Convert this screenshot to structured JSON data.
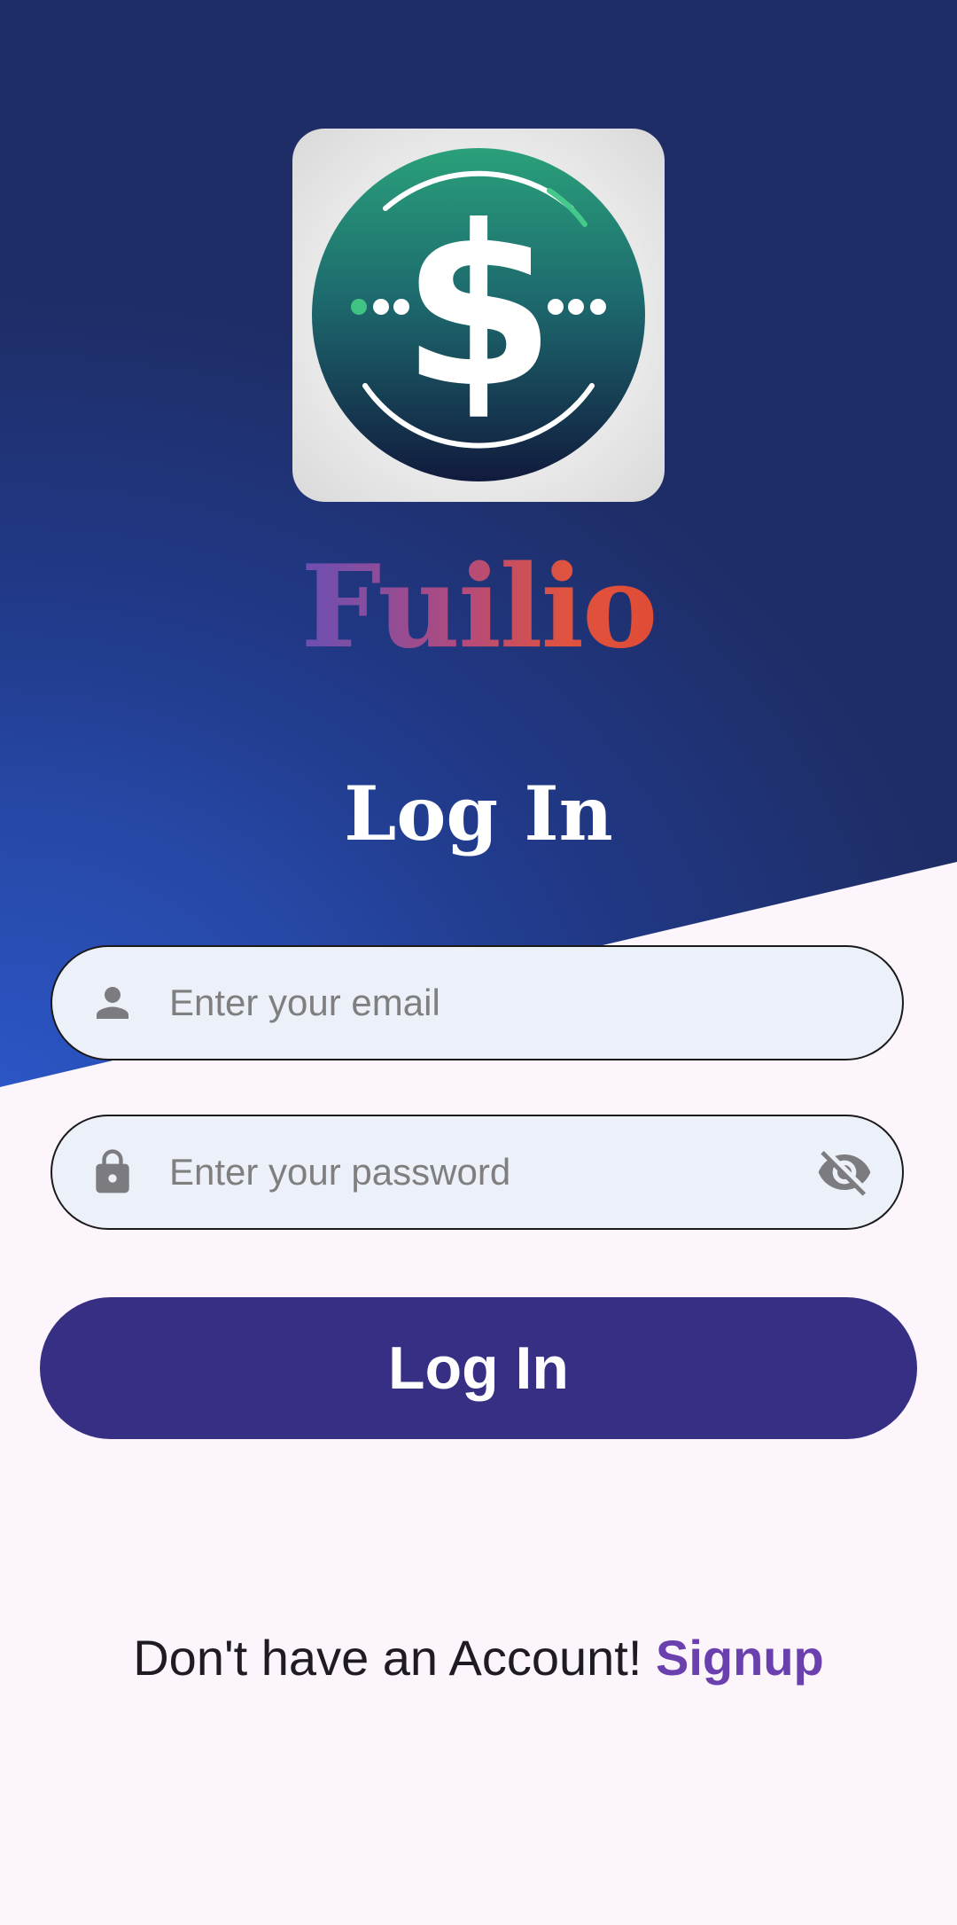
{
  "app": {
    "brand_name": "Fuilio",
    "logo_icon": "dollar-coin-logo"
  },
  "login": {
    "heading": "Log In",
    "email": {
      "placeholder": "Enter your email",
      "value": "",
      "icon": "person-icon"
    },
    "password": {
      "placeholder": "Enter your password",
      "value": "",
      "icon": "lock-icon",
      "toggle_icon": "eye-off-icon"
    },
    "submit_label": "Log In"
  },
  "signup": {
    "prompt": "Don't have an Account!",
    "link_label": "Signup"
  },
  "colors": {
    "hero_blue": "#2648a6",
    "button": "#372f84",
    "link": "#6a3fae",
    "field_bg": "#ecf0f8",
    "page_bg": "#fdf5fc"
  }
}
